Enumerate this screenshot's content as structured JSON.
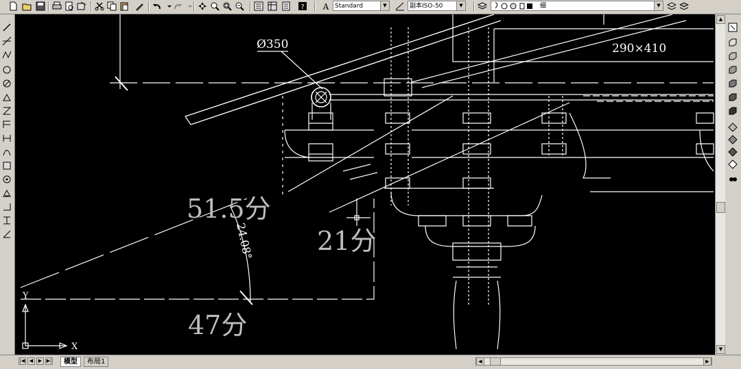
{
  "toolbar": {
    "text_style": "Standard",
    "dim_style": "副本ISO-50",
    "layer": "细",
    "colors": {
      "background": "#d4d0c8",
      "canvas": "#000000",
      "drawing": "#ffffff"
    }
  },
  "drawing": {
    "dim_diameter": "Ø350",
    "dim_section": "290×410",
    "dim_51_5": "51.5分",
    "dim_angle": "24.08°",
    "dim_21": "21分",
    "dim_47": "47分",
    "ucs_y": "Y",
    "ucs_x": "X"
  },
  "tabs": {
    "model": "模型",
    "layout1": "布局1"
  }
}
